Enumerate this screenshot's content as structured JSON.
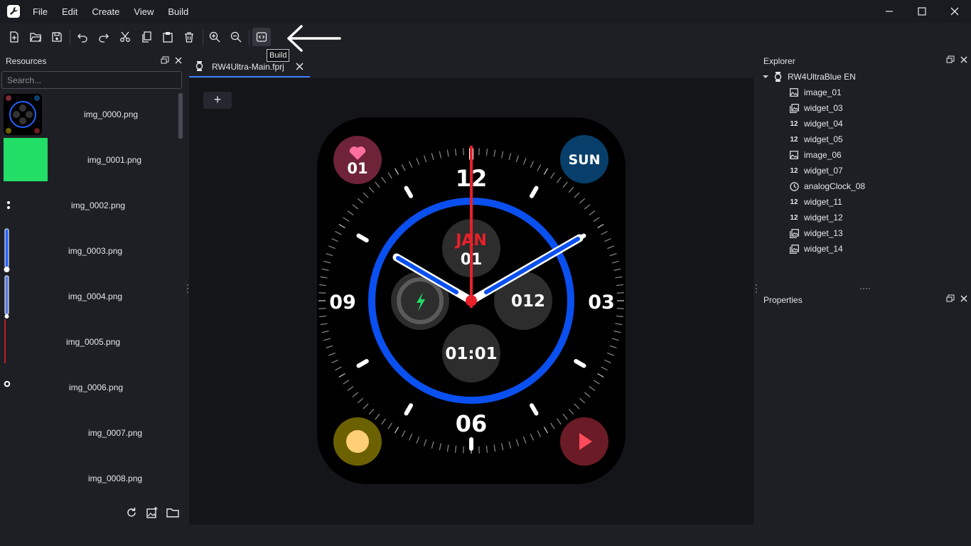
{
  "menu": [
    "File",
    "Edit",
    "Create",
    "View",
    "Build"
  ],
  "toolbar": {
    "buttons": [
      "new-file-icon",
      "open-folder-icon",
      "save-icon",
      "undo-icon",
      "redo-icon",
      "cut-icon",
      "copy-icon",
      "paste-icon",
      "delete-icon",
      "zoom-in-icon",
      "zoom-out-icon",
      "build-icon"
    ],
    "tooltip": "Build"
  },
  "resources": {
    "title": "Resources",
    "search_placeholder": "Search...",
    "items": [
      "img_0000.png",
      "img_0001.png",
      "img_0002.png",
      "img_0003.png",
      "img_0004.png",
      "img_0005.png",
      "img_0006.png",
      "img_0007.png",
      "img_0008.png"
    ]
  },
  "editor": {
    "tab_label": "RW4Ultra-Main.fprj",
    "add_label": "+"
  },
  "watch": {
    "hours": [
      "12",
      "03",
      "06",
      "09"
    ],
    "heart_value": "01",
    "day": "SUN",
    "month": "JAN",
    "date": "01",
    "steps": "012",
    "time": "01:01"
  },
  "explorer": {
    "title": "Explorer",
    "root": "RW4UltraBlue EN",
    "items": [
      {
        "label": "image_01",
        "icon": "image-icon"
      },
      {
        "label": "widget_03",
        "icon": "image-list-icon"
      },
      {
        "label": "widget_04",
        "icon": "number-icon"
      },
      {
        "label": "widget_05",
        "icon": "number-icon"
      },
      {
        "label": "image_06",
        "icon": "image-icon"
      },
      {
        "label": "widget_07",
        "icon": "number-icon"
      },
      {
        "label": "analogClock_08",
        "icon": "clock-icon"
      },
      {
        "label": "widget_11",
        "icon": "number-icon"
      },
      {
        "label": "widget_12",
        "icon": "number-icon"
      },
      {
        "label": "widget_13",
        "icon": "image-list-icon"
      },
      {
        "label": "widget_14",
        "icon": "image-list-icon"
      }
    ],
    "number_glyph": "12"
  },
  "properties": {
    "title": "Properties"
  },
  "colors": {
    "accent": "#3d7dff",
    "watch_ring": "#0a50f0",
    "hand_red": "#e8202a"
  }
}
